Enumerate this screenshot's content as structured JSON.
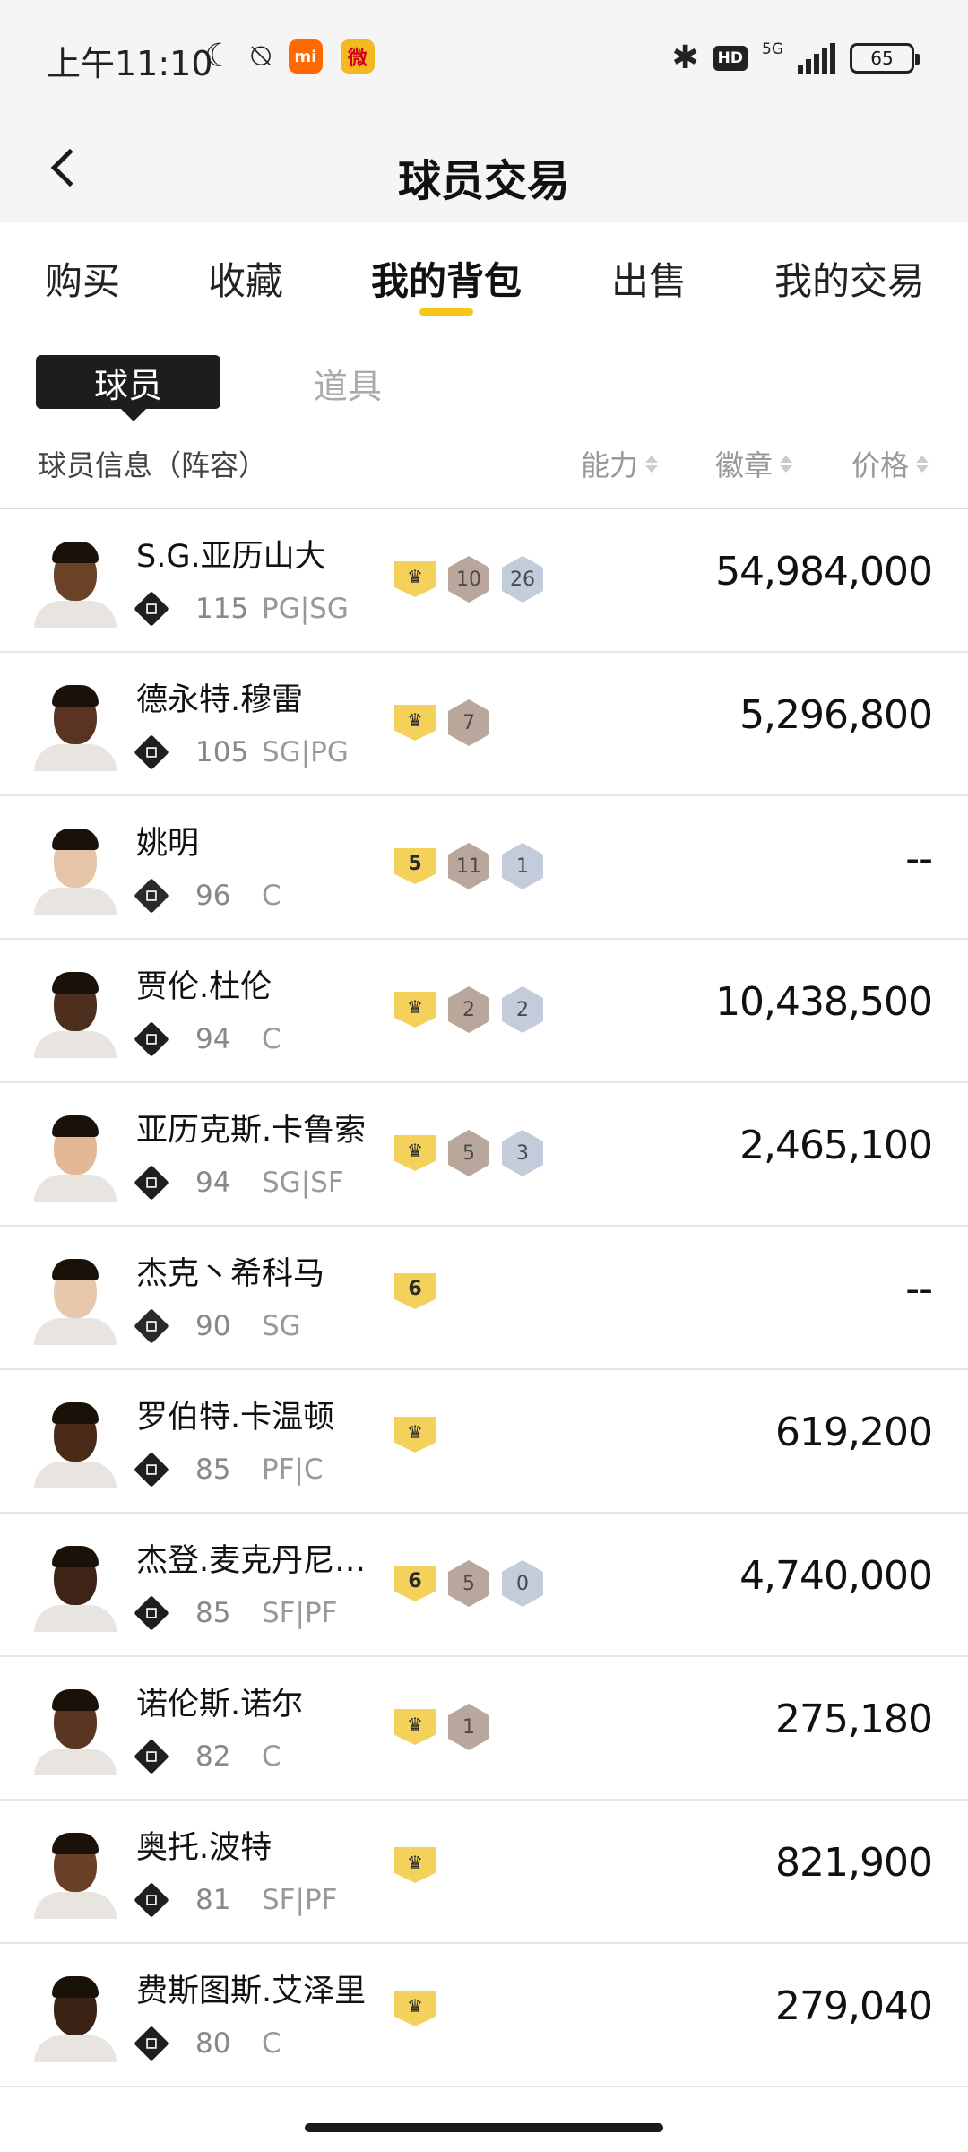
{
  "status_bar": {
    "time": "上午11:10",
    "icons_left": [
      "moon-icon",
      "bell-off-icon",
      "mi-app-icon",
      "weibo-app-icon"
    ],
    "mi_label": "mi",
    "weibo_label": "微",
    "hd": "HD",
    "network": "5G",
    "battery": "65"
  },
  "header": {
    "title": "球员交易"
  },
  "tabs": [
    {
      "label": "购买"
    },
    {
      "label": "收藏"
    },
    {
      "label": "我的背包"
    },
    {
      "label": "出售"
    },
    {
      "label": "我的交易"
    }
  ],
  "active_tab": "我的背包",
  "subtabs": {
    "player": "球员",
    "item": "道具"
  },
  "columns": {
    "info": "球员信息（阵容）",
    "ability": "能力",
    "badge": "徽章",
    "price": "价格"
  },
  "players": [
    {
      "name": "S.G.亚历山大",
      "ovr": "115",
      "pos": "PG|SG",
      "tier": "crown",
      "badges": [
        {
          "v": "10",
          "c": "bronze"
        },
        {
          "v": "26",
          "c": "silver"
        }
      ],
      "price": "54,984,000",
      "skin": "#6b4226"
    },
    {
      "name": "德永特.穆雷",
      "ovr": "105",
      "pos": "SG|PG",
      "tier": "crown",
      "badges": [
        {
          "v": "7",
          "c": "bronze"
        }
      ],
      "price": "5,296,800",
      "skin": "#5a3420"
    },
    {
      "name": "姚明",
      "ovr": "96",
      "pos": "C",
      "tier": "5",
      "badges": [
        {
          "v": "11",
          "c": "bronze"
        },
        {
          "v": "1",
          "c": "silver"
        }
      ],
      "price": "--",
      "skin": "#e6c4a8"
    },
    {
      "name": "贾伦.杜伦",
      "ovr": "94",
      "pos": "C",
      "tier": "crown",
      "badges": [
        {
          "v": "2",
          "c": "bronze"
        },
        {
          "v": "2",
          "c": "silver"
        }
      ],
      "price": "10,438,500",
      "skin": "#4e2e1c"
    },
    {
      "name": "亚历克斯.卡鲁索",
      "ovr": "94",
      "pos": "SG|SF",
      "tier": "crown",
      "badges": [
        {
          "v": "5",
          "c": "bronze"
        },
        {
          "v": "3",
          "c": "silver"
        }
      ],
      "price": "2,465,100",
      "skin": "#e3b896"
    },
    {
      "name": "杰克丶希科马",
      "ovr": "90",
      "pos": "SG",
      "tier": "6",
      "badges": [],
      "price": "--",
      "skin": "#e8c8ac"
    },
    {
      "name": "罗伯特.卡温顿",
      "ovr": "85",
      "pos": "PF|C",
      "tier": "crown",
      "badges": [],
      "price": "619,200",
      "skin": "#4a2a18"
    },
    {
      "name": "杰登.麦克丹尼…",
      "ovr": "85",
      "pos": "SF|PF",
      "tier": "6",
      "badges": [
        {
          "v": "5",
          "c": "bronze"
        },
        {
          "v": "0",
          "c": "silver"
        }
      ],
      "price": "4,740,000",
      "skin": "#3e2416"
    },
    {
      "name": "诺伦斯.诺尔",
      "ovr": "82",
      "pos": "C",
      "tier": "crown",
      "badges": [
        {
          "v": "1",
          "c": "bronze"
        }
      ],
      "price": "275,180",
      "skin": "#5a3522"
    },
    {
      "name": "奥托.波特",
      "ovr": "81",
      "pos": "SF|PF",
      "tier": "crown",
      "badges": [],
      "price": "821,900",
      "skin": "#6a4028"
    },
    {
      "name": "费斯图斯.艾泽里",
      "ovr": "80",
      "pos": "C",
      "tier": "crown",
      "badges": [],
      "price": "279,040",
      "skin": "#3a2214"
    }
  ],
  "crown_glyph": "♛"
}
